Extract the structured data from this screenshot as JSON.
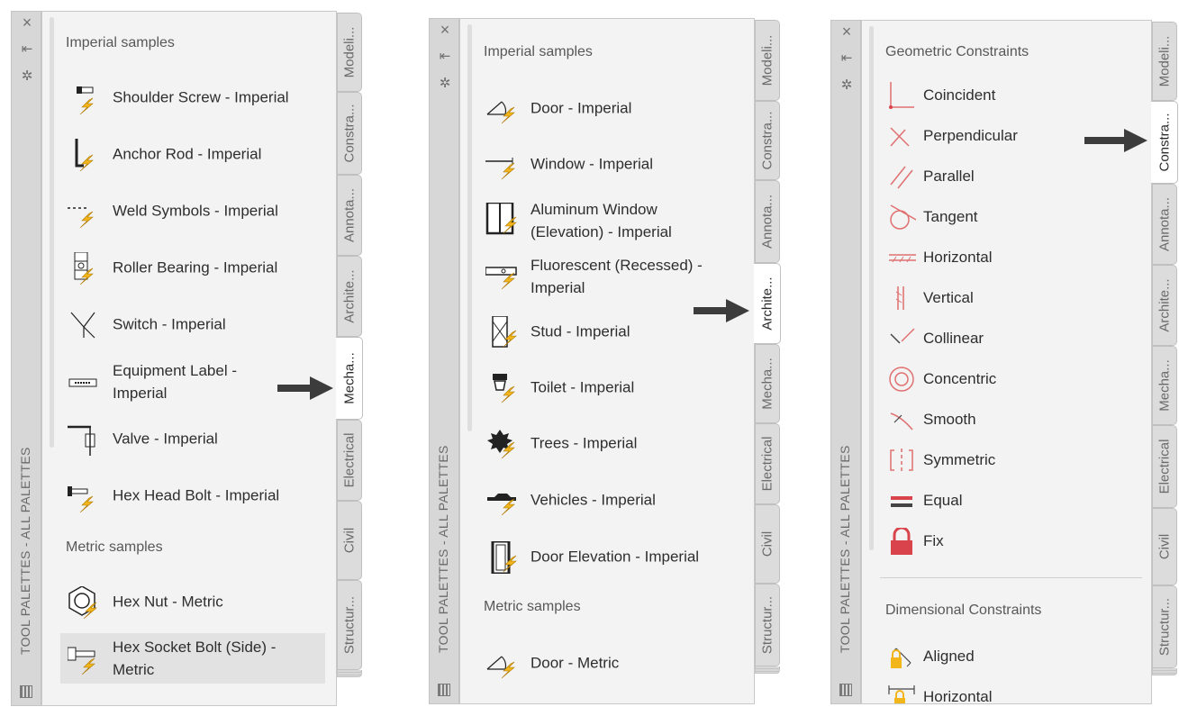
{
  "panel1": {
    "title": "TOOL PALETTES - ALL PALETTES",
    "controls": {
      "close": "×",
      "collapse": "⇤",
      "settings": "✲"
    },
    "section1": "Imperial samples",
    "items": [
      {
        "label": "Shoulder Screw - Imperial",
        "icon": "shoulder-screw-icon"
      },
      {
        "label": "Anchor Rod - Imperial",
        "icon": "anchor-rod-icon"
      },
      {
        "label": "Weld Symbols - Imperial",
        "icon": "weld-symbols-icon"
      },
      {
        "label": "Roller Bearing - Imperial",
        "icon": "roller-bearing-icon"
      },
      {
        "label": "Switch - Imperial",
        "icon": "switch-icon"
      },
      {
        "label": "Equipment Label -\nImperial",
        "icon": "equipment-label-icon"
      },
      {
        "label": "Valve - Imperial",
        "icon": "valve-icon"
      },
      {
        "label": "Hex Head Bolt - Imperial",
        "icon": "hex-head-bolt-icon"
      }
    ],
    "section2": "Metric samples",
    "items2": [
      {
        "label": "Hex Nut - Metric",
        "icon": "hex-nut-icon"
      },
      {
        "label": "Hex Socket Bolt (Side) -\nMetric",
        "icon": "hex-socket-bolt-icon"
      }
    ],
    "tabs": [
      "Modeli...",
      "Constra...",
      "Annota...",
      "Archite...",
      "Mecha...",
      "Electrical",
      "Civil",
      "Structur..."
    ],
    "active_tab": "Mecha..."
  },
  "panel2": {
    "title": "TOOL PALETTES - ALL PALETTES",
    "controls": {
      "close": "×",
      "collapse": "⇤",
      "settings": "✲"
    },
    "section1": "Imperial samples",
    "items": [
      {
        "label": "Door - Imperial",
        "icon": "door-icon"
      },
      {
        "label": "Window - Imperial",
        "icon": "window-icon"
      },
      {
        "label": "Aluminum Window\n(Elevation) - Imperial",
        "icon": "aluminum-window-icon"
      },
      {
        "label": "Fluorescent (Recessed) -\nImperial",
        "icon": "fluorescent-icon"
      },
      {
        "label": "Stud - Imperial",
        "icon": "stud-icon"
      },
      {
        "label": "Toilet - Imperial",
        "icon": "toilet-icon"
      },
      {
        "label": "Trees - Imperial",
        "icon": "trees-icon"
      },
      {
        "label": "Vehicles - Imperial",
        "icon": "vehicles-icon"
      },
      {
        "label": "Door Elevation - Imperial",
        "icon": "door-elevation-icon"
      }
    ],
    "section2": "Metric samples",
    "items2": [
      {
        "label": "Door - Metric",
        "icon": "door-metric-icon"
      }
    ],
    "tabs": [
      "Modeli...",
      "Constra...",
      "Annota...",
      "Archite...",
      "Mecha...",
      "Electrical",
      "Civil",
      "Structur..."
    ],
    "active_tab": "Archite..."
  },
  "panel3": {
    "title": "TOOL PALETTES - ALL PALETTES",
    "controls": {
      "close": "×",
      "collapse": "⇤",
      "settings": "✲"
    },
    "section1": "Geometric Constraints",
    "items": [
      {
        "label": "Coincident",
        "icon": "coincident-icon"
      },
      {
        "label": "Perpendicular",
        "icon": "perpendicular-icon"
      },
      {
        "label": "Parallel",
        "icon": "parallel-icon"
      },
      {
        "label": "Tangent",
        "icon": "tangent-icon"
      },
      {
        "label": "Horizontal",
        "icon": "horizontal-icon"
      },
      {
        "label": "Vertical",
        "icon": "vertical-icon"
      },
      {
        "label": "Collinear",
        "icon": "collinear-icon"
      },
      {
        "label": "Concentric",
        "icon": "concentric-icon"
      },
      {
        "label": "Smooth",
        "icon": "smooth-icon"
      },
      {
        "label": "Symmetric",
        "icon": "symmetric-icon"
      },
      {
        "label": "Equal",
        "icon": "equal-icon"
      },
      {
        "label": "Fix",
        "icon": "fix-icon"
      }
    ],
    "section2": "Dimensional Constraints",
    "items2": [
      {
        "label": "Aligned",
        "icon": "aligned-icon"
      },
      {
        "label": "Horizontal",
        "icon": "dim-horizontal-icon"
      }
    ],
    "tabs": [
      "Modeli...",
      "Constra...",
      "Annota...",
      "Archite...",
      "Mecha...",
      "Electrical",
      "Civil",
      "Structur..."
    ],
    "active_tab": "Constra..."
  },
  "colors": {
    "accent_red": "#d9434b",
    "lightning": "#f2b51a",
    "arrow": "#3c3c3c"
  }
}
